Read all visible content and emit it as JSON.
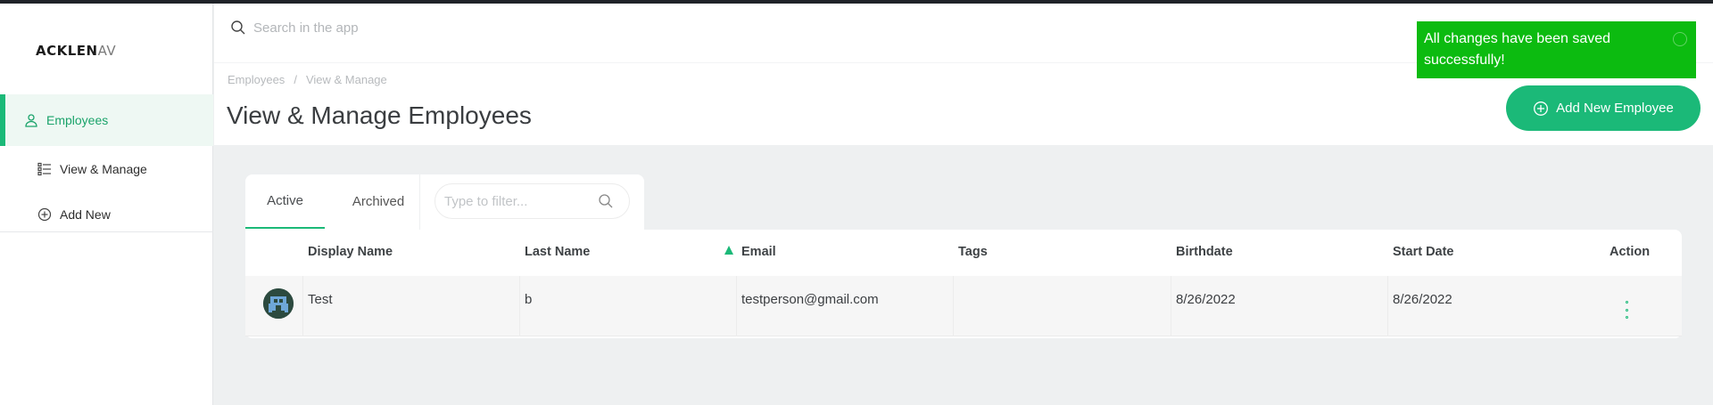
{
  "app": {
    "logo_text": "ACKLENAV",
    "logo_visible": "ACKLEN",
    "logo_faded": "AV"
  },
  "sidebar": {
    "items": [
      {
        "label": "Employees",
        "icon": "user-icon",
        "active": true
      },
      {
        "label": "View & Manage",
        "icon": "list-icon",
        "active": false
      },
      {
        "label": "Add New",
        "icon": "plus-circle-icon",
        "active": false
      }
    ]
  },
  "search": {
    "placeholder": "Search in the app"
  },
  "breadcrumb": {
    "items": [
      "Employees",
      "View & Manage"
    ],
    "separator": "/"
  },
  "page": {
    "title": "View & Manage Employees"
  },
  "actions": {
    "add_new_label": "Add New Employee"
  },
  "toast": {
    "message": "All changes have been saved successfully!",
    "color": "#0cbb10"
  },
  "tabs": [
    {
      "label": "Active",
      "active": true
    },
    {
      "label": "Archived",
      "active": false
    }
  ],
  "filter": {
    "placeholder": "Type to filter..."
  },
  "table": {
    "columns": [
      "Display Name",
      "Last Name",
      "Email",
      "Tags",
      "Birthdate",
      "Start Date",
      "Action"
    ],
    "sorted_column": "Email",
    "sort_direction": "ascending",
    "rows": [
      {
        "display_name": "Test",
        "last_name": "b",
        "email": "testperson@gmail.com",
        "tags": "",
        "birthdate": "8/26/2022",
        "start_date": "8/26/2022"
      }
    ]
  },
  "colors": {
    "accent": "#1bb978",
    "background": "#eef0f1",
    "toast_green": "#0cbb10"
  }
}
